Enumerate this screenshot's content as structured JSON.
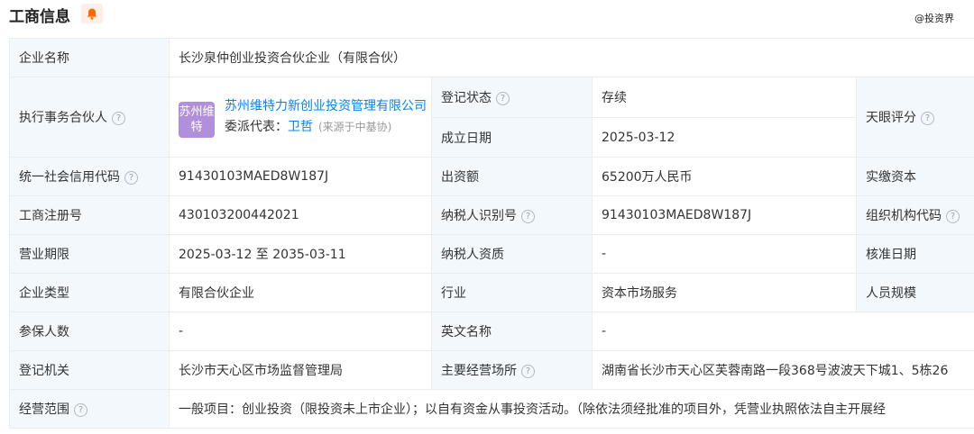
{
  "header": {
    "title": "工商信息",
    "watermark": "@投资界"
  },
  "rows": {
    "company_name": {
      "label": "企业名称",
      "value": "长沙泉仲创业投资合伙企业（有限合伙）"
    },
    "exec_partner": {
      "label": "执行事务合伙人",
      "logo_text": "苏州维特",
      "name": "苏州维特力新创业投资管理有限公司",
      "rep_label": "委派代表：",
      "rep_name": "卫哲",
      "rep_source": "(来源于中基协)"
    },
    "reg_status": {
      "label": "登记状态",
      "value": "存续"
    },
    "found_date": {
      "label": "成立日期",
      "value": "2025-03-12"
    },
    "tianyan_score": {
      "label": "天眼评分"
    },
    "credit_code": {
      "label": "统一社会信用代码",
      "value": "91430103MAED8W187J"
    },
    "capital": {
      "label": "出资额",
      "value": "65200万人民币"
    },
    "paid_capital": {
      "label": "实缴资本"
    },
    "reg_no": {
      "label": "工商注册号",
      "value": "430103200442021"
    },
    "taxpayer_id": {
      "label": "纳税人识别号",
      "value": "91430103MAED8W187J"
    },
    "org_code": {
      "label": "组织机构代码"
    },
    "term": {
      "label": "营业期限",
      "value": "2025-03-12 至 2035-03-11"
    },
    "tax_quali": {
      "label": "纳税人资质",
      "value": "-"
    },
    "approve_date": {
      "label": "核准日期"
    },
    "type": {
      "label": "企业类型",
      "value": "有限合伙企业"
    },
    "industry": {
      "label": "行业",
      "value": "资本市场服务"
    },
    "staff": {
      "label": "人员规模"
    },
    "insured": {
      "label": "参保人数",
      "value": "-"
    },
    "en_name": {
      "label": "英文名称",
      "value": "-"
    },
    "authority": {
      "label": "登记机关",
      "value": "长沙市天心区市场监督管理局"
    },
    "address": {
      "label": "主要经营场所",
      "value": "湖南省长沙市天心区芙蓉南路一段368号波波天下城1、5栋26"
    },
    "scope": {
      "label": "经营范围",
      "value": "一般项目：创业投资（限投资未上市企业）；以自有资金从事投资活动。（除依法须经批准的项目外，凭营业执照依法自主开展经"
    }
  },
  "icons": {
    "bell": "bell-icon",
    "help": "question-icon"
  },
  "colors": {
    "label_bg": "#f3f8fd",
    "border": "#e9edf2",
    "link": "#0084ff",
    "status": "#18a058",
    "bell": "#ff6a00"
  }
}
